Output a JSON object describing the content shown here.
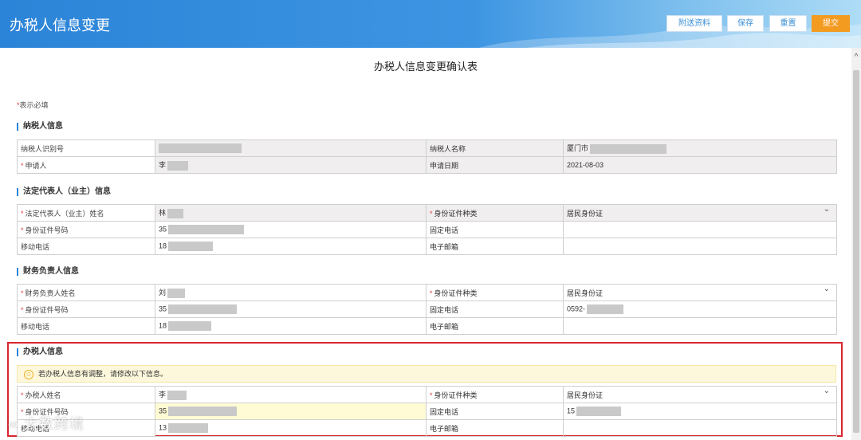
{
  "header": {
    "title": "办税人信息变更",
    "buttons": {
      "attach": "附送资料",
      "save": "保存",
      "reset": "重置",
      "submit": "提交"
    }
  },
  "form_title": "办税人信息变更确认表",
  "required_note": {
    "star": "*",
    "text": "表示必填"
  },
  "sections": {
    "taxpayer": {
      "title": "纳税人信息",
      "taxpayer_id_label": "纳税人识别号",
      "taxpayer_name_label": "纳税人名称",
      "taxpayer_name_value": "厦门市",
      "applicant_label": "申请人",
      "applicant_value": "李",
      "apply_date_label": "申请日期",
      "apply_date_value": "2021-08-03"
    },
    "legal": {
      "title": "法定代表人（业主）信息",
      "name_label": "法定代表人（业主）姓名",
      "name_value": "林",
      "id_type_label": "身份证件种类",
      "id_type_value": "居民身份证",
      "id_no_label": "身份证件号码",
      "id_no_value": "35",
      "phone_label": "固定电话",
      "mobile_label": "移动电话",
      "mobile_value": "18",
      "email_label": "电子邮箱"
    },
    "finance": {
      "title": "财务负责人信息",
      "name_label": "财务负责人姓名",
      "name_value": "刘",
      "id_type_label": "身份证件种类",
      "id_type_value": "居民身份证",
      "id_no_label": "身份证件号码",
      "id_no_value": "35",
      "phone_label": "固定电话",
      "phone_value": "0592-",
      "mobile_label": "移动电话",
      "mobile_value": "18",
      "email_label": "电子邮箱"
    },
    "agent": {
      "title": "办税人信息",
      "notice": "若办税人信息有调整，请修改以下信息。",
      "name_label": "办税人姓名",
      "name_value": "李",
      "id_type_label": "身份证件种类",
      "id_type_value": "居民身份证",
      "id_no_label": "身份证件号码",
      "id_no_value": "35",
      "phone_label": "固定电话",
      "phone_value": "15",
      "mobile_label": "移动电话",
      "mobile_value": "13",
      "email_label": "电子邮箱"
    }
  },
  "watermark": "大数跨境",
  "colors": {
    "header_blue": "#2c84d8",
    "submit_orange": "#f39a21",
    "highlight_red": "#d9262e"
  }
}
